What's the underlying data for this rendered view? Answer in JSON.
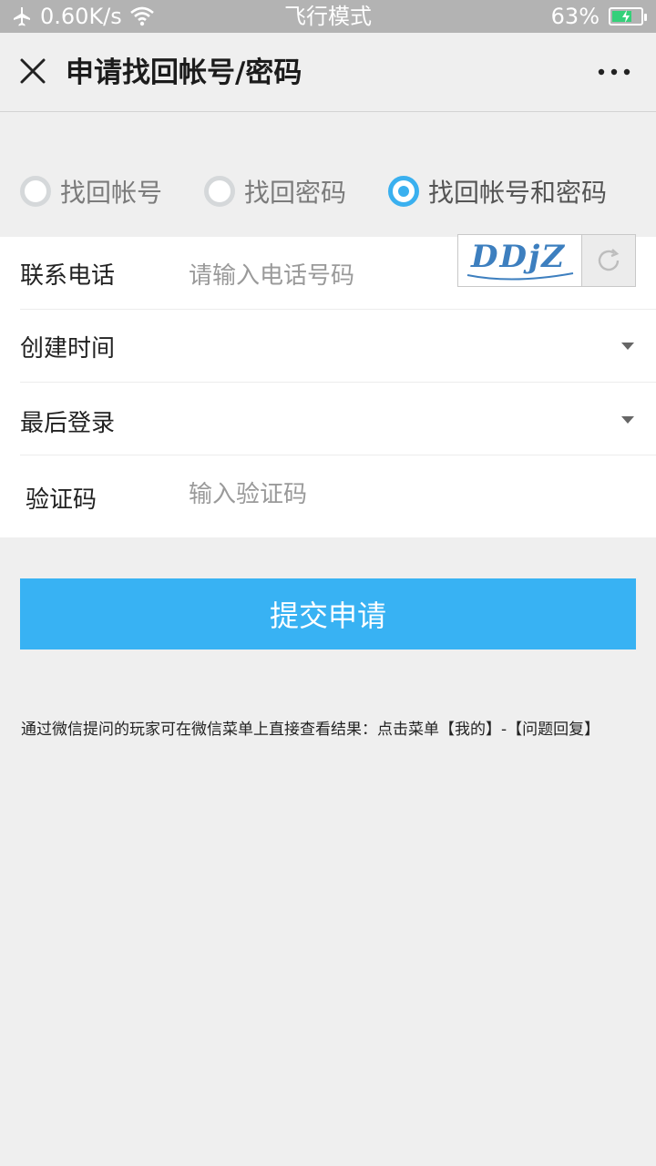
{
  "status_bar": {
    "speed": "0.60K/s",
    "center": "飞行模式",
    "battery": "63%",
    "icons": [
      "airplane-icon",
      "wifi-icon",
      "battery-icon"
    ]
  },
  "header": {
    "title": "申请找回帐号/密码",
    "close_icon": "close-icon",
    "more_icon": "more-icon"
  },
  "options": [
    {
      "label": "找回帐号",
      "checked": false
    },
    {
      "label": "找回密码",
      "checked": false
    },
    {
      "label": "找回帐号和密码",
      "checked": true
    }
  ],
  "form": {
    "phone": {
      "label": "联系电话",
      "placeholder": "请输入电话号码"
    },
    "created": {
      "label": "创建时间",
      "value": ""
    },
    "last_login": {
      "label": "最后登录",
      "value": ""
    },
    "captcha": {
      "label": "验证码",
      "placeholder": "输入验证码",
      "image_text": "DDjZ"
    }
  },
  "submit_label": "提交申请",
  "hint": "通过微信提问的玩家可在微信菜单上直接查看结果：点击菜单【我的】-【问题回复】",
  "colors": {
    "accent": "#38b2f3",
    "radio_on": "#3ab0ef",
    "background": "#efefef"
  }
}
